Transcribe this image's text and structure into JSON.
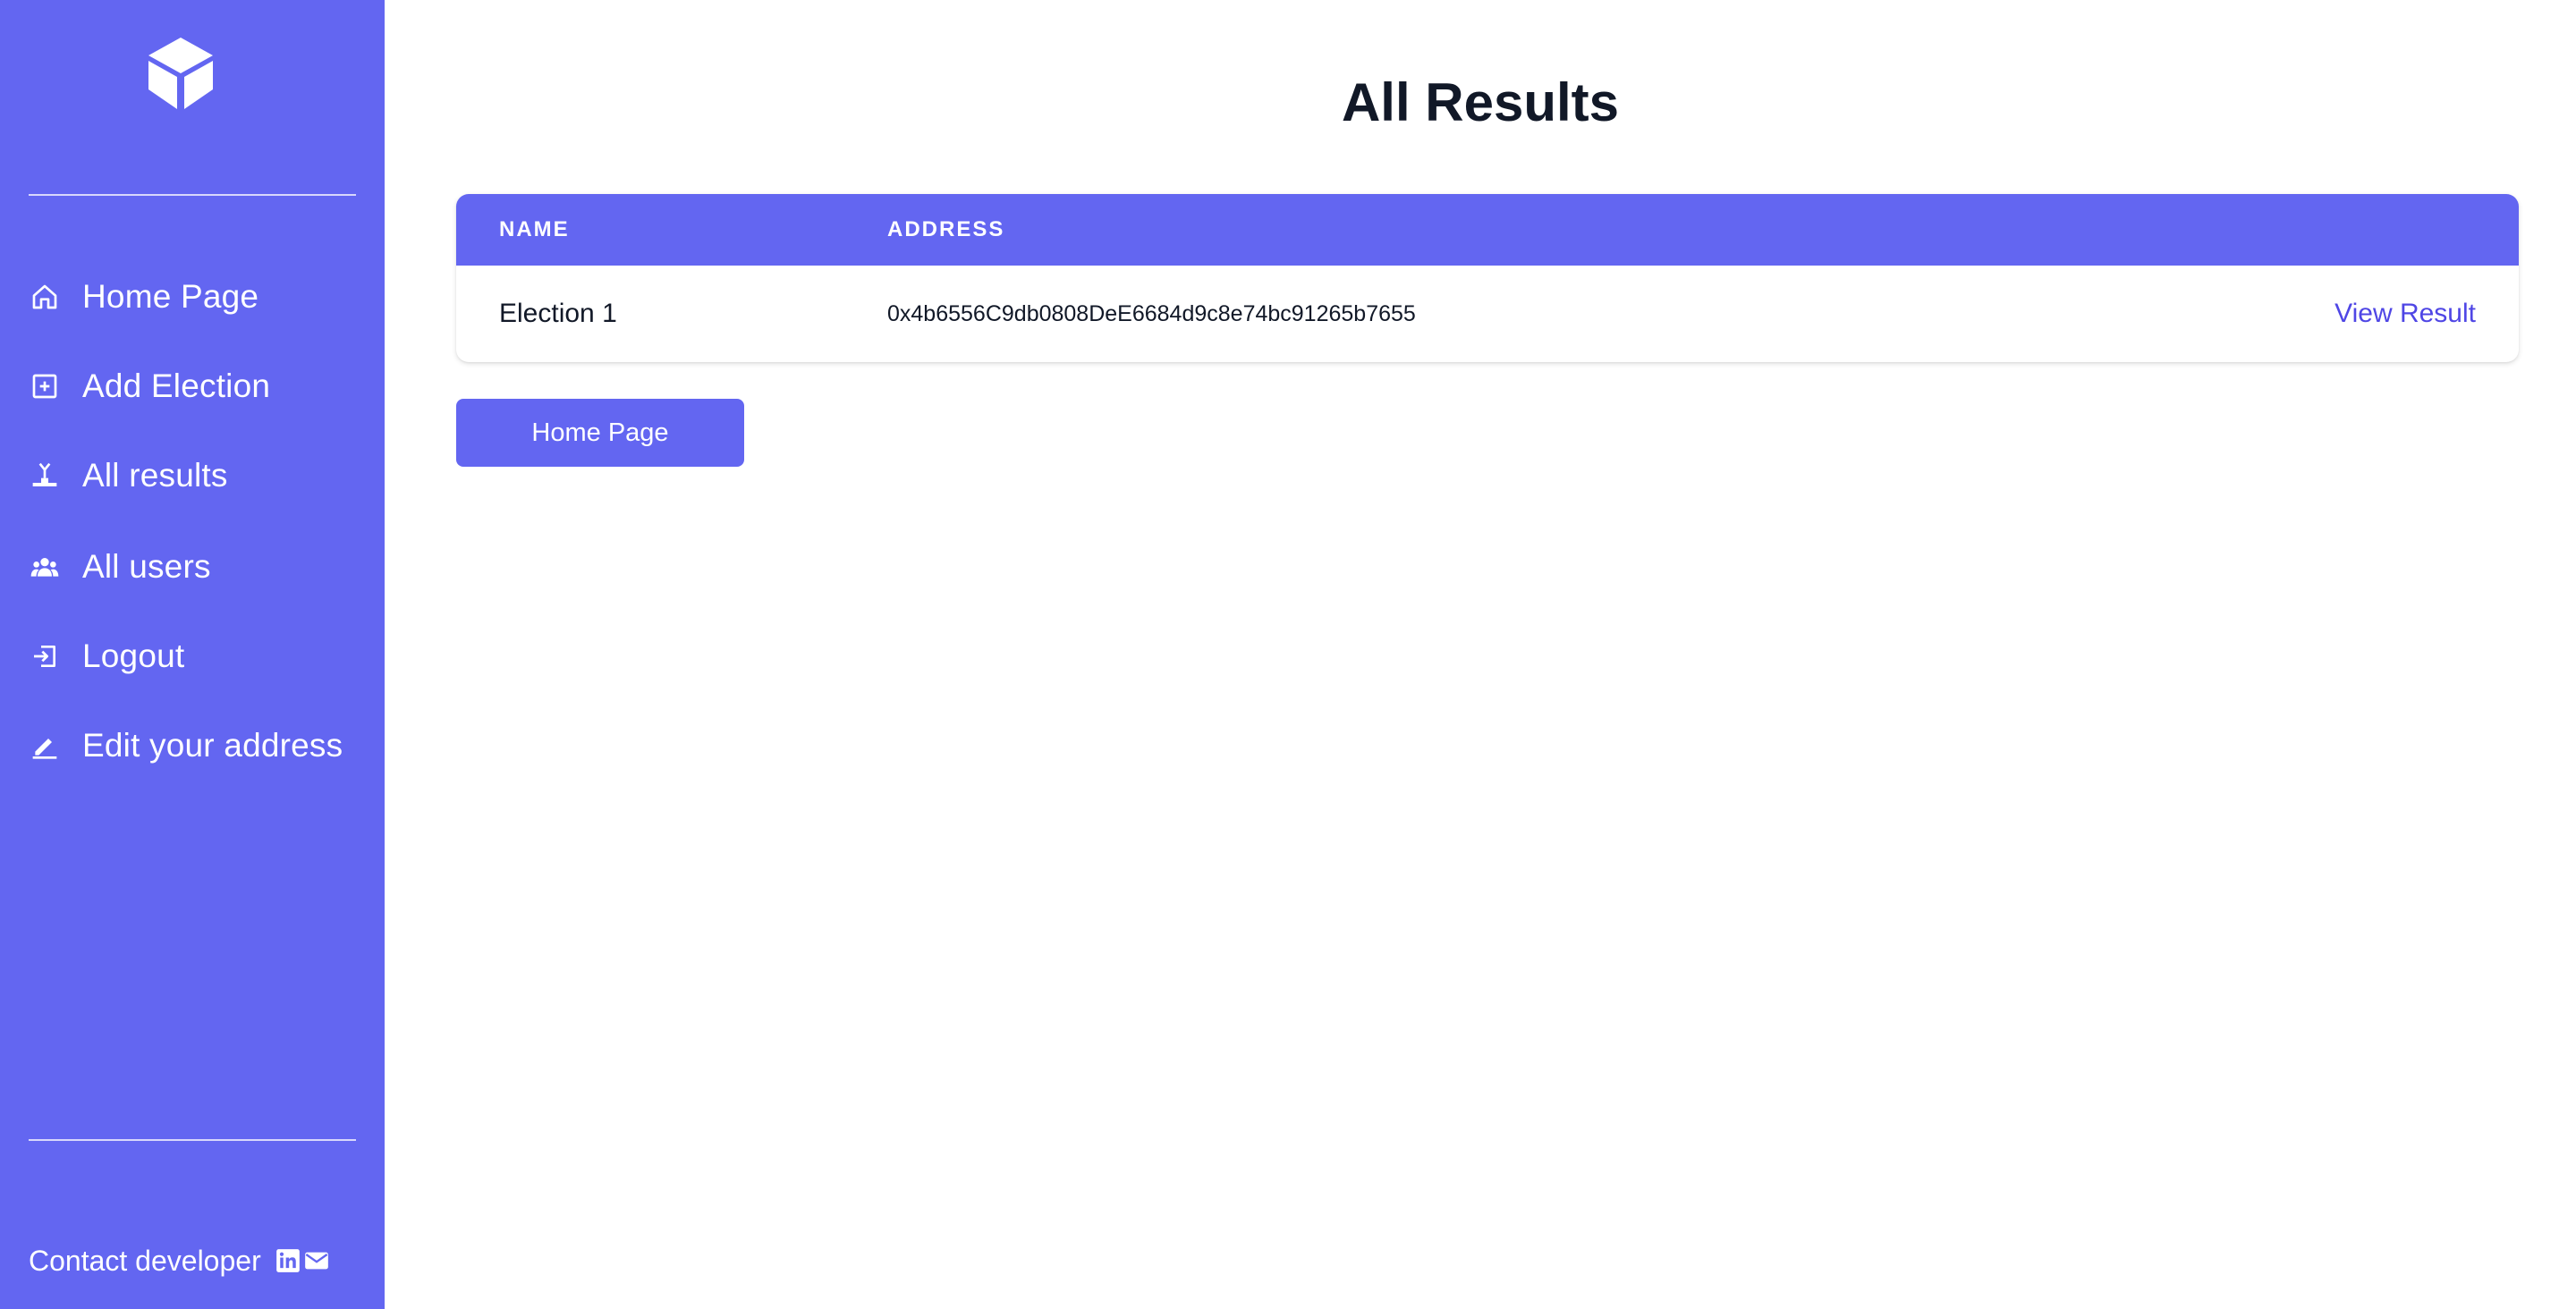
{
  "sidebar": {
    "logo_icon": "cube-logo-icon",
    "items": [
      {
        "label": "Home Page",
        "icon": "home-icon"
      },
      {
        "label": "Add Election",
        "icon": "plus-square-icon"
      },
      {
        "label": "All results",
        "icon": "podium-icon"
      },
      {
        "label": "All users",
        "icon": "users-icon"
      },
      {
        "label": "Logout",
        "icon": "logout-icon"
      },
      {
        "label": "Edit your address",
        "icon": "pencil-icon"
      }
    ],
    "contact": {
      "label": "Contact developer",
      "icons": [
        "linkedin-icon",
        "mail-icon"
      ]
    }
  },
  "main": {
    "title": "All Results",
    "table": {
      "headers": [
        "NAME",
        "ADDRESS"
      ],
      "rows": [
        {
          "name": "Election 1",
          "address": "0x4b6556C9db0808DeE6684d9c8e74bc91265b7655",
          "action": "View Result"
        }
      ]
    },
    "home_button": "Home Page"
  },
  "colors": {
    "accent": "#6366f1",
    "link": "#4f46e5",
    "title": "#111827"
  }
}
